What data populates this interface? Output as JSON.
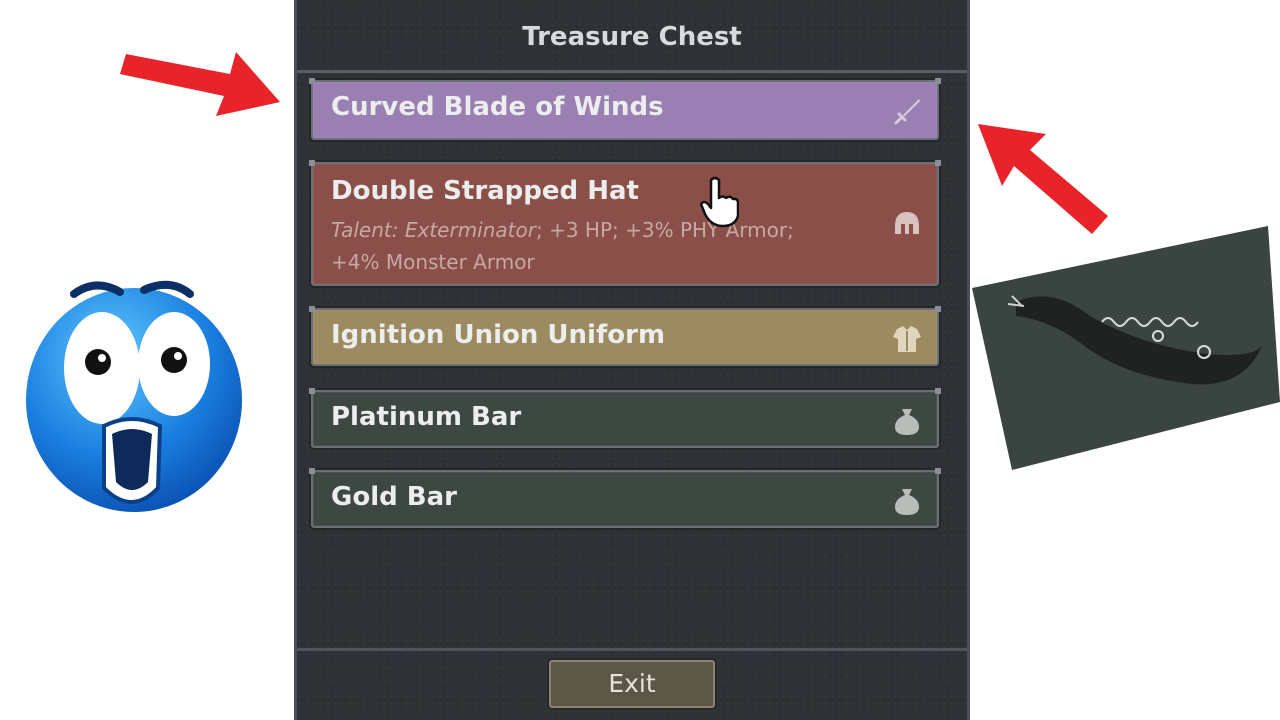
{
  "chest": {
    "title": "Treasure Chest",
    "items": [
      {
        "name": "Curved Blade of Winds",
        "icon": "sword-icon",
        "color": "#9a7fb3"
      },
      {
        "name": "Double Strapped Hat",
        "desc_talent": "Talent: Exterminator",
        "desc_rest": "; +3 HP; +3% PHY Armor; +4% Monster Armor",
        "icon": "helmet-icon",
        "color": "#8b4f4a"
      },
      {
        "name": "Ignition Union Uniform",
        "icon": "armor-icon",
        "color": "#9c8a60"
      },
      {
        "name": "Platinum Bar",
        "icon": "pouch-icon",
        "color": "#3e4843"
      },
      {
        "name": "Gold Bar",
        "icon": "pouch-icon",
        "color": "#3e4843"
      }
    ],
    "exit_label": "Exit"
  },
  "decor": {
    "arrow_color": "#e8242a",
    "emoji": "shocked-face",
    "photo": "curved-sword-image"
  }
}
